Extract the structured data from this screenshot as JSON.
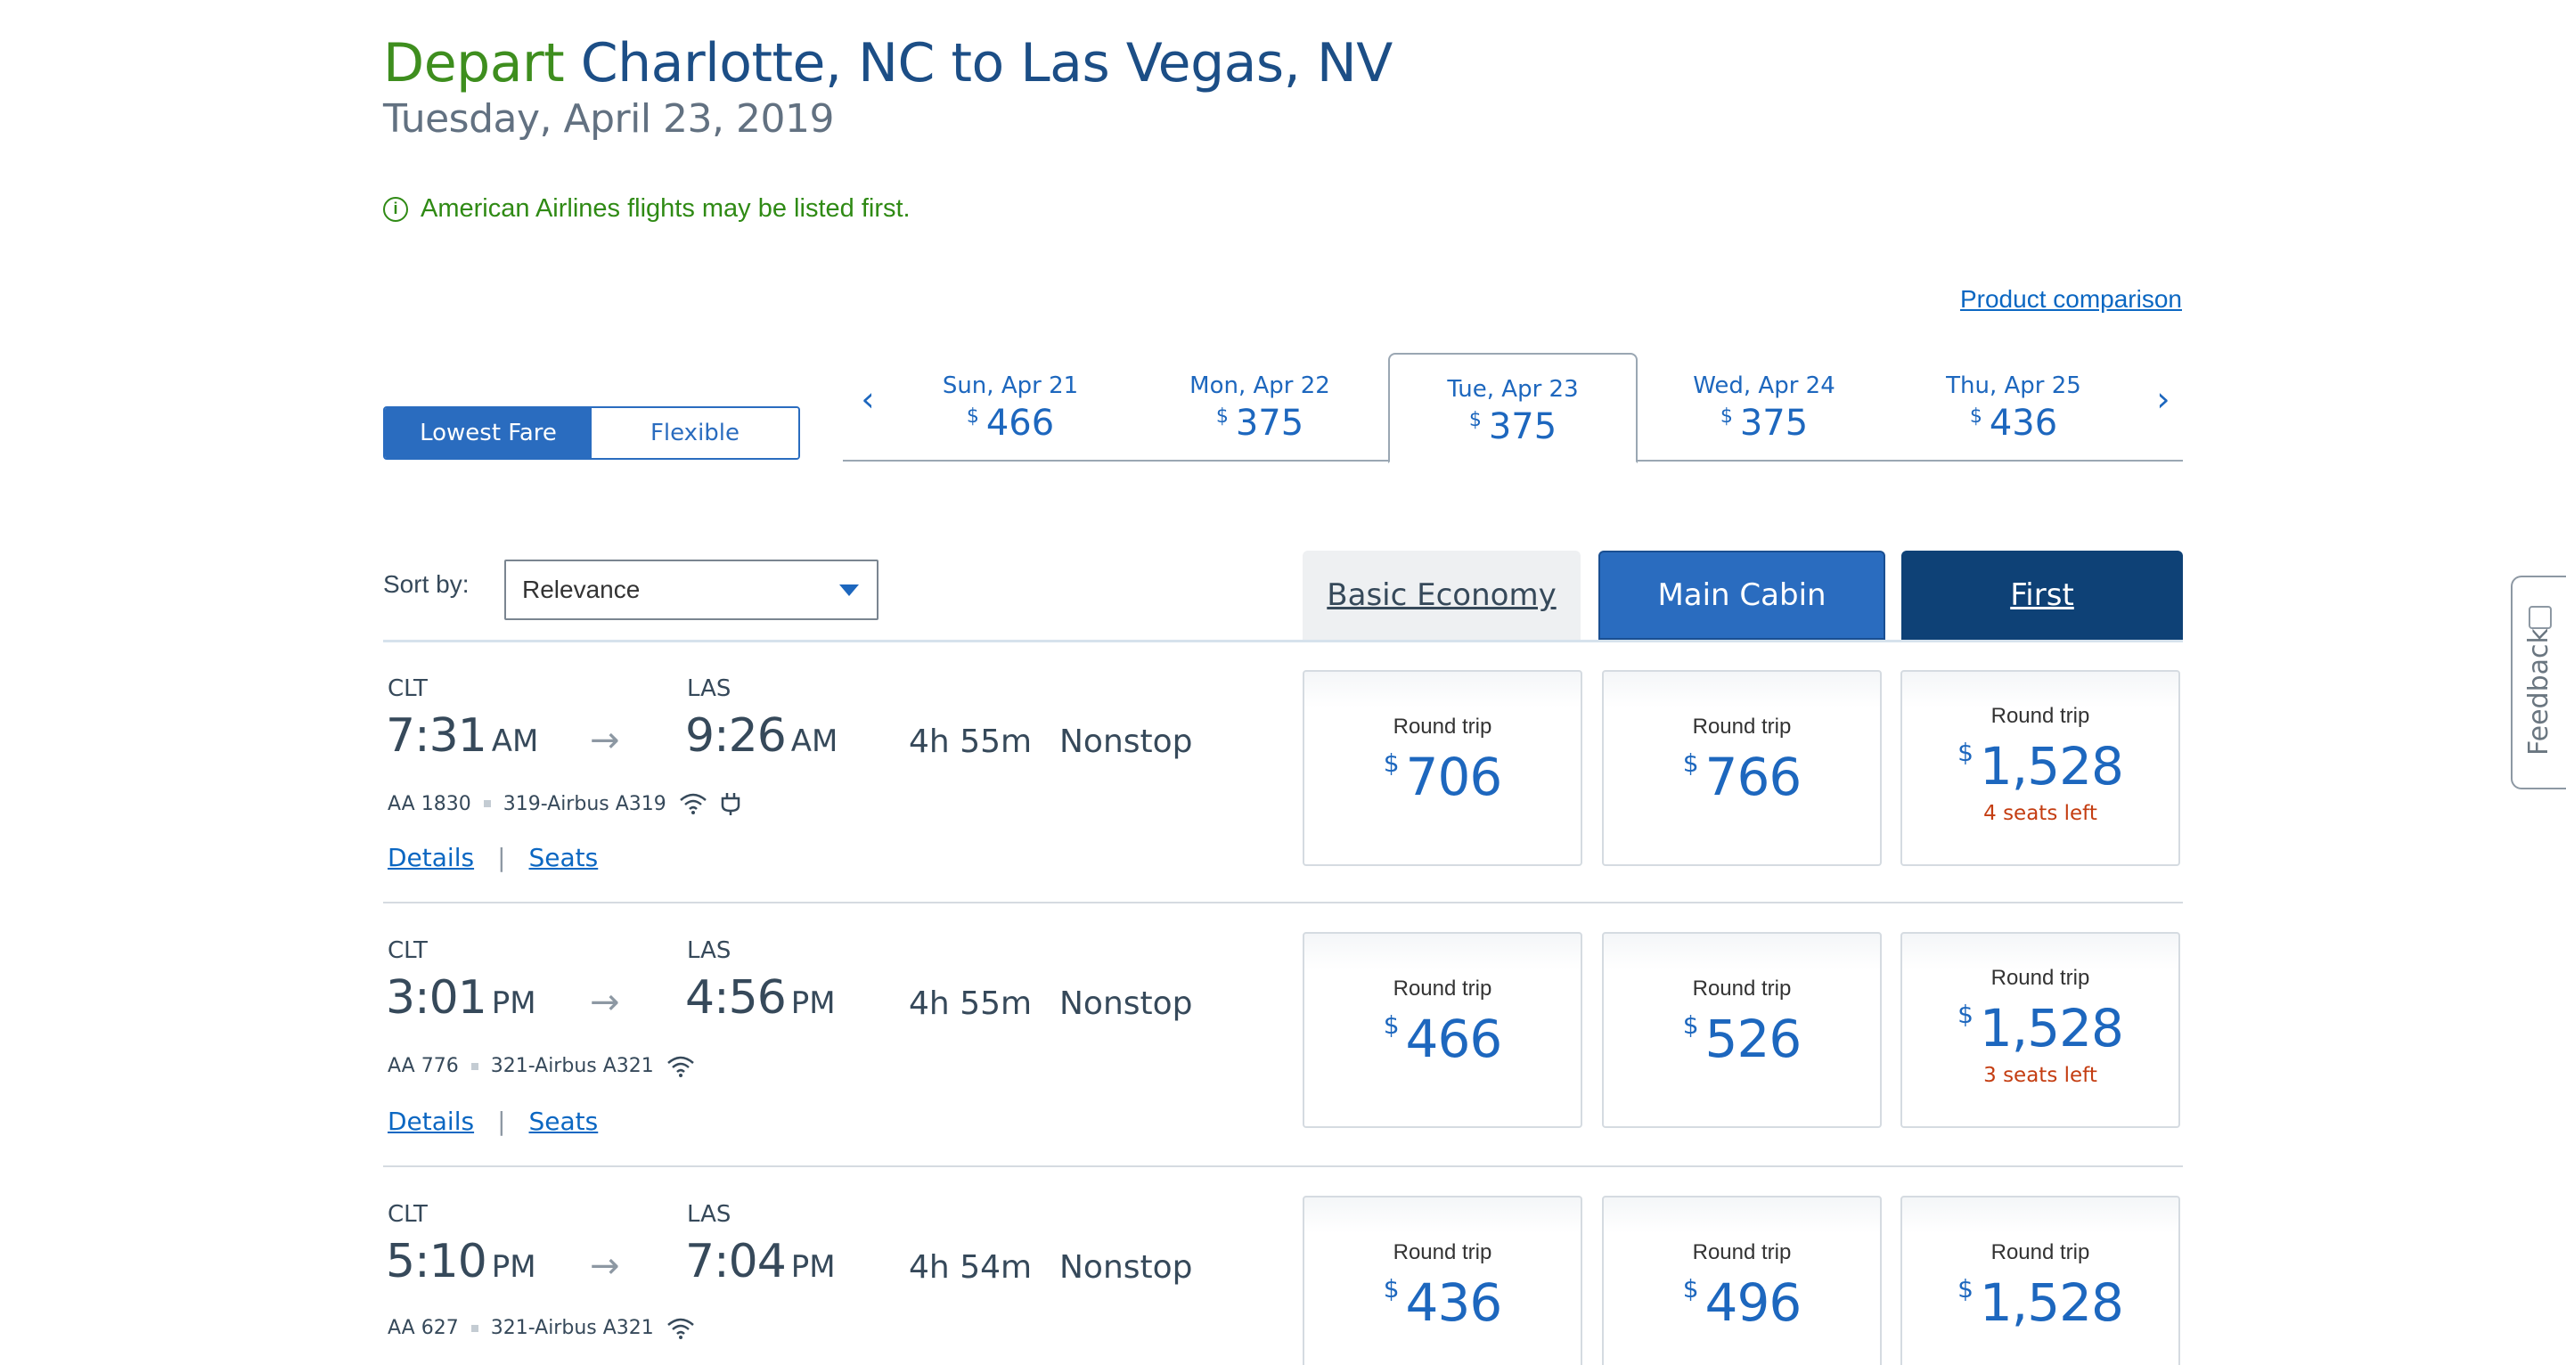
{
  "header": {
    "depart_word": "Depart",
    "route": "Charlotte, NC to Las Vegas, NV",
    "date": "Tuesday, April 23, 2019",
    "notice": "American Airlines flights may be listed first.",
    "product_comparison": "Product comparison"
  },
  "fare_toggle": {
    "lowest": "Lowest Fare",
    "flexible": "Flexible"
  },
  "dates": [
    {
      "label": "Sun, Apr 21",
      "currency": "$",
      "price": "466"
    },
    {
      "label": "Mon, Apr 22",
      "currency": "$",
      "price": "375"
    },
    {
      "label": "Tue, Apr 23",
      "currency": "$",
      "price": "375"
    },
    {
      "label": "Wed, Apr 24",
      "currency": "$",
      "price": "375"
    },
    {
      "label": "Thu, Apr 25",
      "currency": "$",
      "price": "436"
    }
  ],
  "sort": {
    "label": "Sort by:",
    "value": "Relevance"
  },
  "cabins": {
    "basic": "Basic Economy",
    "main": "Main Cabin",
    "first": "First"
  },
  "flights": [
    {
      "origin": "CLT",
      "depart_time": "7:31",
      "depart_ampm": "AM",
      "dest": "LAS",
      "arrive_time": "9:26",
      "arrive_ampm": "AM",
      "duration_h": "4h",
      "duration_m": "55m",
      "stops": "Nonstop",
      "flight_no": "AA 1830",
      "aircraft": "319-Airbus A319",
      "details": "Details",
      "pipe": "|",
      "seats": "Seats",
      "prices": [
        {
          "label": "Round trip",
          "currency": "$",
          "amount": "706",
          "seats_left": ""
        },
        {
          "label": "Round trip",
          "currency": "$",
          "amount": "766",
          "seats_left": ""
        },
        {
          "label": "Round trip",
          "currency": "$",
          "amount": "1,528",
          "seats_left": "4 seats left"
        }
      ]
    },
    {
      "origin": "CLT",
      "depart_time": "3:01",
      "depart_ampm": "PM",
      "dest": "LAS",
      "arrive_time": "4:56",
      "arrive_ampm": "PM",
      "duration_h": "4h",
      "duration_m": "55m",
      "stops": "Nonstop",
      "flight_no": "AA 776",
      "aircraft": "321-Airbus A321",
      "details": "Details",
      "pipe": "|",
      "seats": "Seats",
      "prices": [
        {
          "label": "Round trip",
          "currency": "$",
          "amount": "466",
          "seats_left": ""
        },
        {
          "label": "Round trip",
          "currency": "$",
          "amount": "526",
          "seats_left": ""
        },
        {
          "label": "Round trip",
          "currency": "$",
          "amount": "1,528",
          "seats_left": "3 seats left"
        }
      ]
    },
    {
      "origin": "CLT",
      "depart_time": "5:10",
      "depart_ampm": "PM",
      "dest": "LAS",
      "arrive_time": "7:04",
      "arrive_ampm": "PM",
      "duration_h": "4h",
      "duration_m": "54m",
      "stops": "Nonstop",
      "flight_no": "AA 627",
      "aircraft": "321-Airbus A321",
      "prices": [
        {
          "label": "Round trip",
          "currency": "$",
          "amount": "436",
          "seats_left": ""
        },
        {
          "label": "Round trip",
          "currency": "$",
          "amount": "496",
          "seats_left": ""
        },
        {
          "label": "Round trip",
          "currency": "$",
          "amount": "1,528",
          "seats_left": ""
        }
      ]
    }
  ],
  "feedback": "Feedback"
}
